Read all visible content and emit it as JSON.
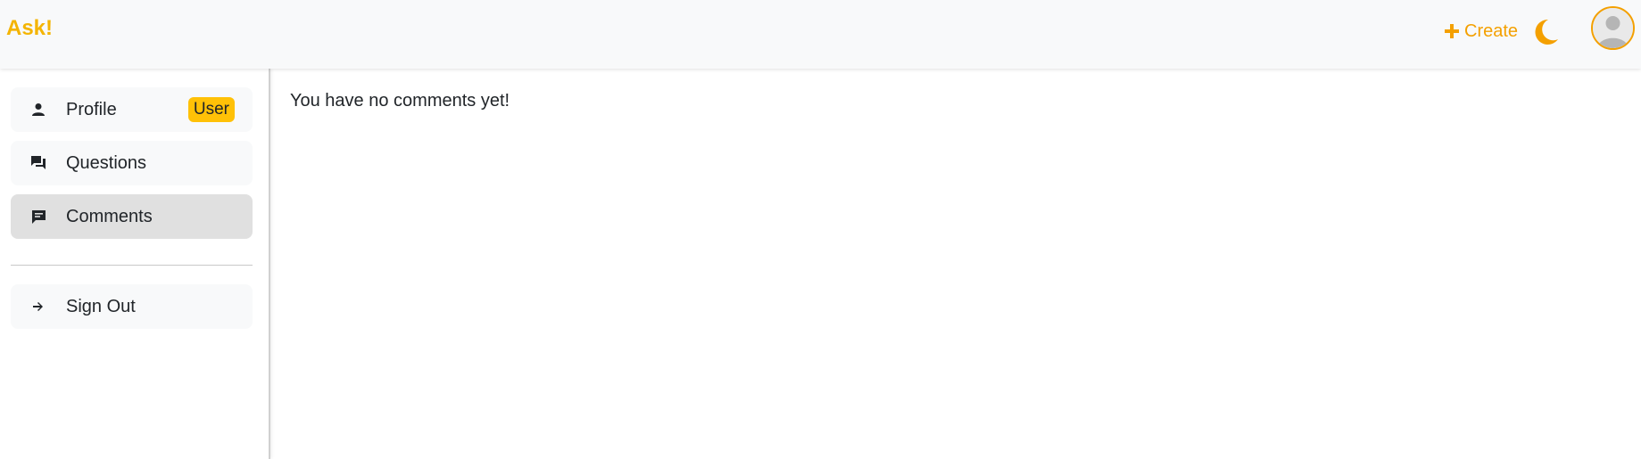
{
  "header": {
    "brand": "Ask!",
    "create_label": "Create",
    "accent_color": "#f4a000",
    "icons": [
      "plus-icon",
      "moon-icon",
      "avatar-icon"
    ]
  },
  "sidebar": {
    "items": [
      {
        "label": "Profile",
        "icon": "person-icon",
        "badge": "User",
        "active": false
      },
      {
        "label": "Questions",
        "icon": "forum-icon",
        "active": false
      },
      {
        "label": "Comments",
        "icon": "comment-icon",
        "active": true
      },
      {
        "label": "Sign Out",
        "icon": "arrow-right-icon",
        "active": false
      }
    ]
  },
  "main": {
    "empty_message": "You have no comments yet!"
  }
}
